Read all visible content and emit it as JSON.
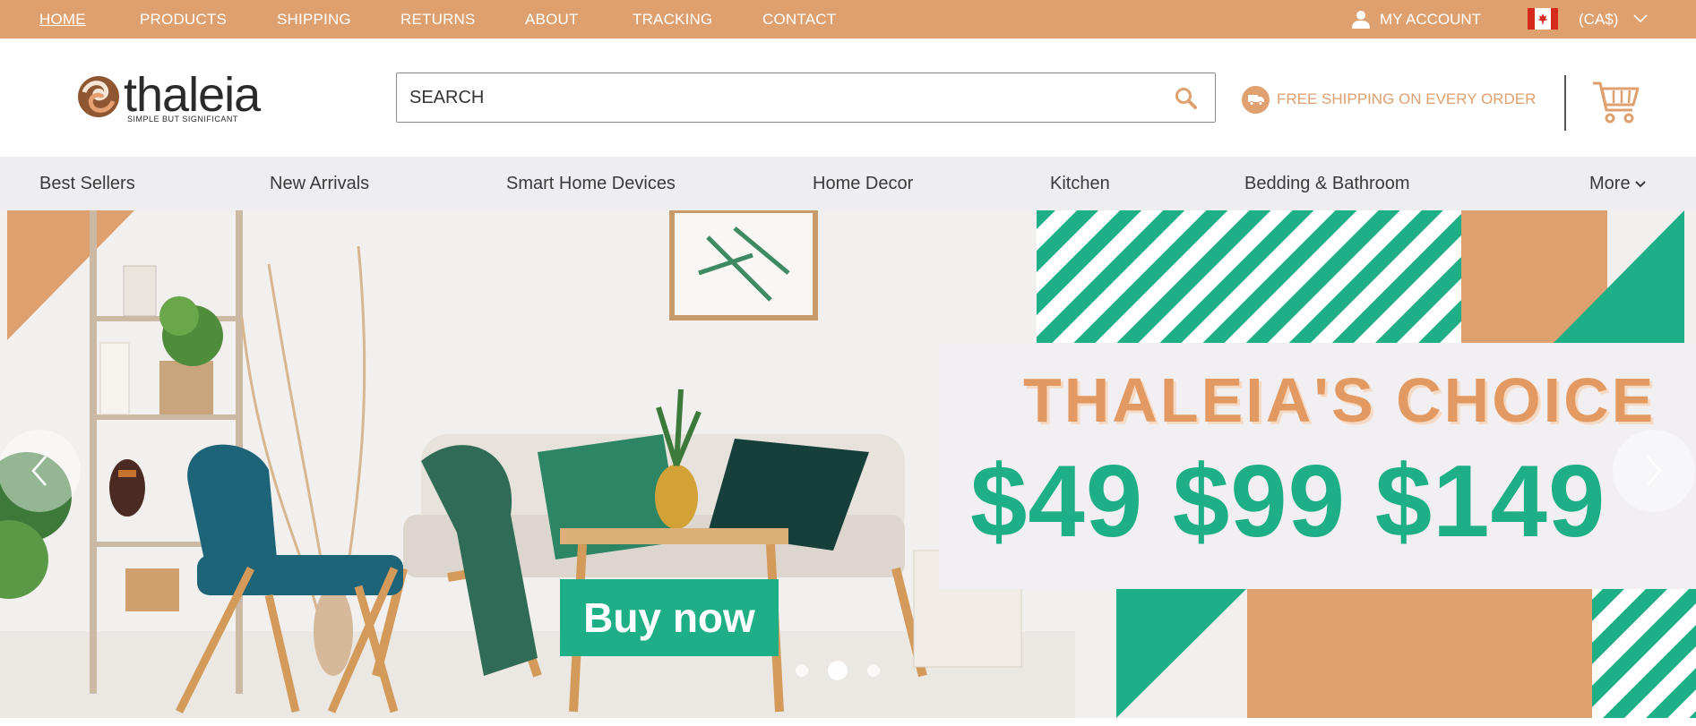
{
  "topbar": {
    "nav": [
      {
        "label": "HOME",
        "active": true
      },
      {
        "label": "PRODUCTS"
      },
      {
        "label": "SHIPPING"
      },
      {
        "label": "RETURNS"
      },
      {
        "label": "ABOUT"
      },
      {
        "label": "TRACKING"
      },
      {
        "label": "CONTACT"
      }
    ],
    "account_label": "MY ACCOUNT",
    "account_icon": "user-icon",
    "flag_icon": "canada-flag-icon",
    "currency": "(CA$)"
  },
  "header": {
    "logo_text": "thaleia",
    "logo_tagline": "SIMPLE BUT SIGNIFICANT",
    "search_placeholder": "SEARCH",
    "search_icon": "search-icon",
    "shipping_text": "FREE SHIPPING ON EVERY ORDER",
    "shipping_icon": "truck-icon",
    "cart_icon": "cart-icon"
  },
  "categories": [
    {
      "label": "Best Sellers"
    },
    {
      "label": "New Arrivals"
    },
    {
      "label": "Smart Home Devices"
    },
    {
      "label": "Home Decor"
    },
    {
      "label": "Kitchen"
    },
    {
      "label": "Bedding & Bathroom"
    },
    {
      "label": "More"
    }
  ],
  "hero": {
    "title": "THALEIA'S CHOICE",
    "prices": "$49 $99 $149",
    "button_label": "Buy now",
    "slides": 3,
    "active_slide": 2
  },
  "colors": {
    "accent": "#dfa06f",
    "green": "#1faf86",
    "nav_bg": "#eeeef1"
  }
}
